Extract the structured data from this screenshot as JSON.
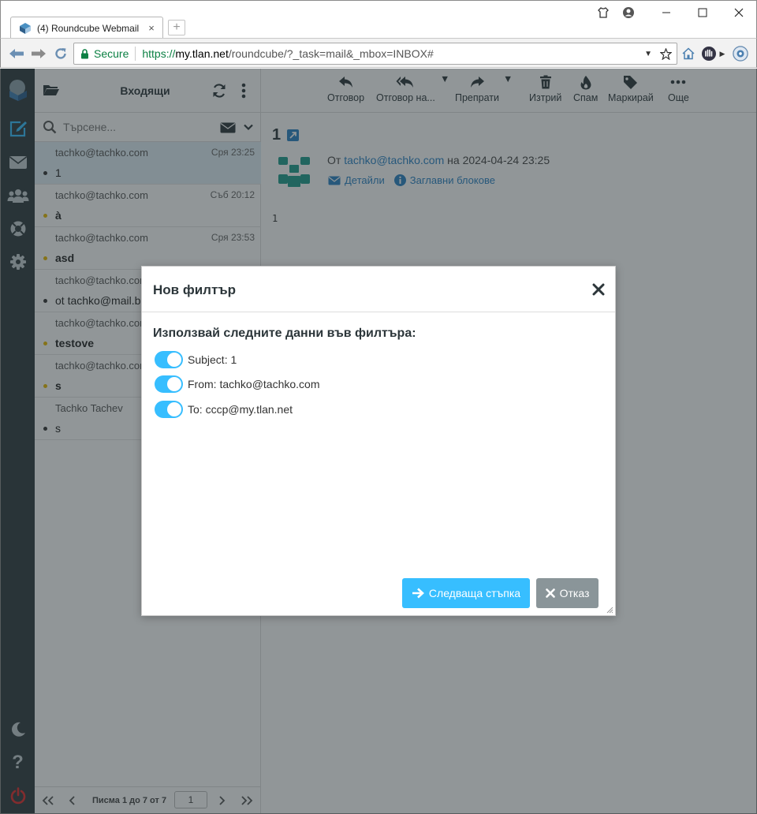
{
  "browser": {
    "tab_title": "(4) Roundcube Webmail",
    "secure_label": "Secure",
    "url_scheme": "https://",
    "url_host": "my.tlan.net",
    "url_path": "/roundcube/?_task=mail&_mbox=INBOX#"
  },
  "list": {
    "folder_title": "Входящи",
    "search_placeholder": "Търсене...",
    "messages": [
      {
        "from": "tachko@tachko.com",
        "date": "Сря 23:25",
        "subject": "1",
        "bold": false,
        "dot": "dark"
      },
      {
        "from": "tachko@tachko.com",
        "date": "Съб 20:12",
        "subject": "à",
        "bold": true,
        "dot": "yellow"
      },
      {
        "from": "tachko@tachko.com",
        "date": "Сря 23:53",
        "subject": "asd",
        "bold": true,
        "dot": "yellow"
      },
      {
        "from": "tachko@tachko.com",
        "date": "",
        "subject": "ot tachko@mail.b",
        "bold": false,
        "dot": "dark"
      },
      {
        "from": "tachko@tachko.com",
        "date": "",
        "subject": "testove",
        "bold": true,
        "dot": "yellow"
      },
      {
        "from": "tachko@tachko.com",
        "date": "",
        "subject": "s",
        "bold": true,
        "dot": "yellow"
      },
      {
        "from": "Tachko Tachev",
        "date": "",
        "subject": "s",
        "bold": false,
        "dot": "dark"
      }
    ],
    "pager_text": "Писма 1 до 7 от 7",
    "page_number": "1"
  },
  "toolbar": {
    "reply": "Отговор",
    "reply_all": "Отговор на...",
    "forward": "Препрати",
    "delete": "Изтрий",
    "spam": "Спам",
    "mark": "Маркирай",
    "more": "Още"
  },
  "message": {
    "subject": "1",
    "from_prefix": "От",
    "from_email": "tachko@tachko.com",
    "date_prefix": "на",
    "date": "2024-04-24 23:25",
    "details_link": "Детайли",
    "headers_link": "Заглавни блокове",
    "body": "1"
  },
  "dialog": {
    "title": "Нов филтър",
    "label": "Използвай следните данни във филтъра:",
    "options": [
      {
        "text": "Subject: 1",
        "checked": true
      },
      {
        "text": "From: tachko@tachko.com",
        "checked": true
      },
      {
        "text": "To: cccp@my.tlan.net",
        "checked": true
      }
    ],
    "next_button": "Следваща стъпка",
    "cancel_button": "Отказ"
  },
  "colors": {
    "accent": "#37beff",
    "sidebar": "#2f3a3f",
    "cancel": "#8a9599"
  }
}
